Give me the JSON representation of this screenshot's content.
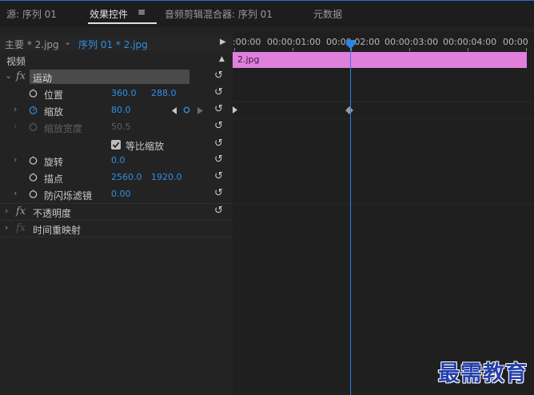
{
  "tabs": {
    "source": "源: 序列 01",
    "effects": "效果控件",
    "effects_menu": "≡",
    "audio_mixer": "音频剪辑混合器: 序列 01",
    "metadata": "元数据"
  },
  "header": {
    "master": "主要 * 2.jpg",
    "sequence": "序列 01 * 2.jpg",
    "play": "▶"
  },
  "video_section": {
    "label": "视频",
    "collapse": "▲"
  },
  "motion": {
    "label": "运动",
    "position": {
      "label": "位置",
      "x": "360.0",
      "y": "288.0"
    },
    "scale": {
      "label": "缩放",
      "value": "80.0"
    },
    "scale_width": {
      "label": "缩放宽度",
      "value": "50.5"
    },
    "uniform_scale": {
      "label": "等比缩放",
      "checked": true
    },
    "rotation": {
      "label": "旋转",
      "value": "0.0"
    },
    "anchor": {
      "label": "描点",
      "x": "2560.0",
      "y": "1920.0"
    },
    "antiflicker": {
      "label": "防闪烁滤镜",
      "value": "0.00"
    }
  },
  "opacity": {
    "label": "不透明度"
  },
  "time_remap": {
    "label": "时间重映射"
  },
  "timeline": {
    "ticks": [
      ":00:00",
      "00:00:01:00",
      "00:00:02:00",
      "00:00:03:00",
      "00:00:04:00",
      "00:00"
    ],
    "clip_label": "2.jpg",
    "accent": "#2e82e6",
    "clip_color": "#e07fdc"
  },
  "watermark": "最需教育"
}
